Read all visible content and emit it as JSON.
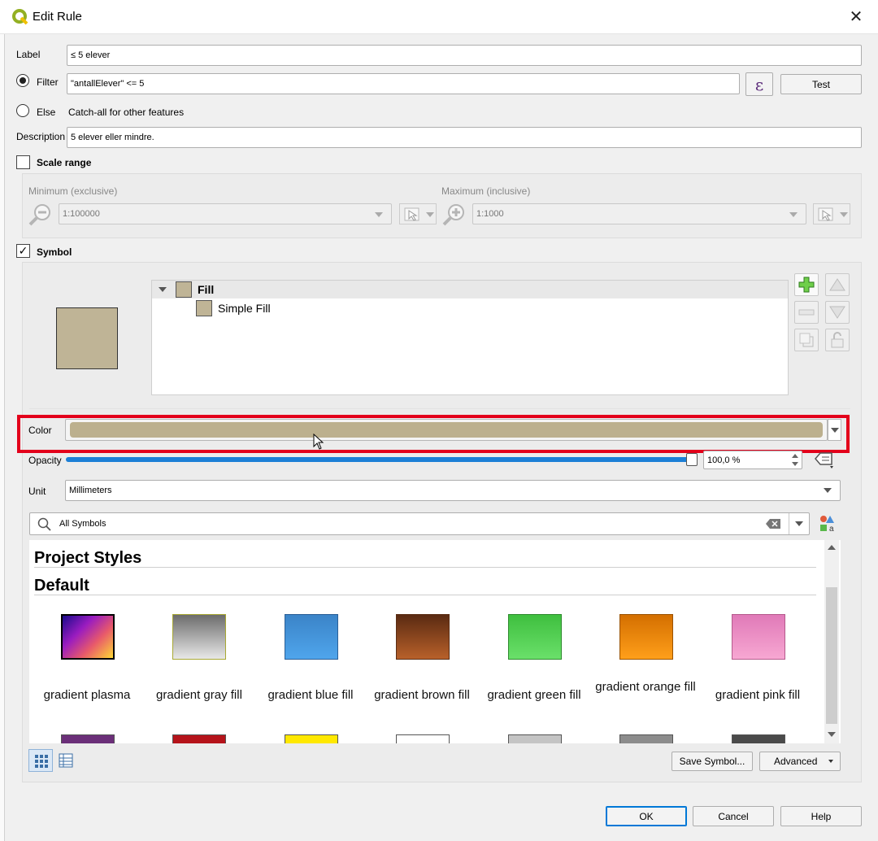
{
  "window": {
    "title": "Edit Rule"
  },
  "label": {
    "caption": "Label",
    "value": "≤ 5 elever"
  },
  "filter": {
    "caption": "Filter",
    "value": "\"antallElever\" <= 5",
    "expression_glyph": "ε",
    "test_label": "Test"
  },
  "else": {
    "caption": "Else",
    "note": "Catch-all for other features"
  },
  "description": {
    "caption": "Description",
    "value": "5 elever eller mindre."
  },
  "scale_range": {
    "caption": "Scale range",
    "min_label": "Minimum (exclusive)",
    "min_value": "1:100000",
    "max_label": "Maximum (inclusive)",
    "max_value": "1:1000"
  },
  "symbol": {
    "caption": "Symbol",
    "preview_color": "#bfb496",
    "layers": [
      {
        "label": "Fill"
      },
      {
        "label": "Simple Fill"
      }
    ]
  },
  "color": {
    "caption": "Color",
    "value": "#bcb08e"
  },
  "opacity": {
    "caption": "Opacity",
    "value_text": "100,0 %",
    "fraction": 1.0
  },
  "unit": {
    "caption": "Unit",
    "value": "Millimeters"
  },
  "search": {
    "value": "All Symbols"
  },
  "library": {
    "project_heading": "Project Styles",
    "default_heading": "Default",
    "items": [
      {
        "label": "gradient   plasma"
      },
      {
        "label": "gradient  gray fill"
      },
      {
        "label": "gradient blue fill"
      },
      {
        "label": "gradient brown fill"
      },
      {
        "label": "gradient green fill"
      },
      {
        "label": "gradient orange fill"
      },
      {
        "label": "gradient pink fill"
      }
    ],
    "row2_colors": [
      "#6b2f79",
      "#b5131a",
      "#ffe800",
      "#ffffff",
      "#c4c4c4",
      "#8c8c8c",
      "#4a4a4a"
    ]
  },
  "buttons": {
    "save_symbol": "Save Symbol...",
    "advanced": "Advanced",
    "ok": "OK",
    "cancel": "Cancel",
    "help": "Help"
  },
  "colors": {
    "highlight": "#e3001b",
    "accent": "#0078d7"
  }
}
